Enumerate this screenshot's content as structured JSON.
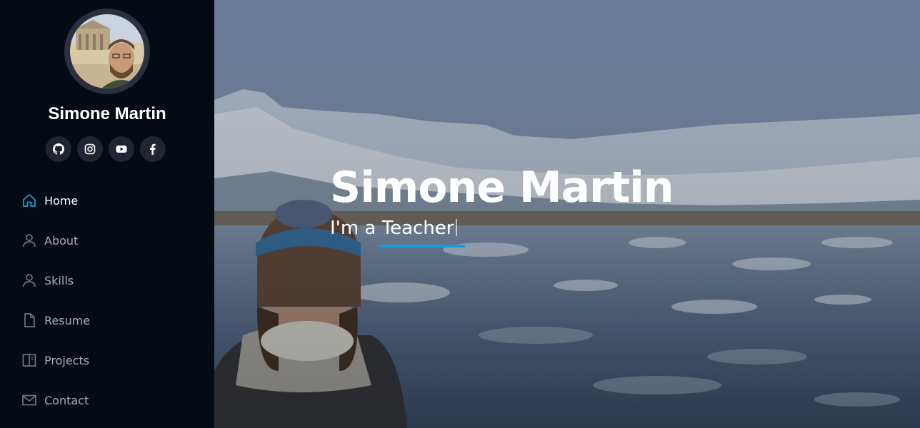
{
  "profile": {
    "name": "Simone Martin",
    "avatar_alt": "profile photo"
  },
  "socials": [
    {
      "icon": "github-icon"
    },
    {
      "icon": "instagram-icon"
    },
    {
      "icon": "youtube-icon"
    },
    {
      "icon": "facebook-icon"
    }
  ],
  "nav": {
    "items": [
      {
        "label": "Home",
        "icon": "home-icon",
        "active": true
      },
      {
        "label": "About",
        "icon": "person-icon"
      },
      {
        "label": "Skills",
        "icon": "person-icon"
      },
      {
        "label": "Resume",
        "icon": "file-icon"
      },
      {
        "label": "Projects",
        "icon": "columns-icon"
      },
      {
        "label": "Contact",
        "icon": "envelope-icon"
      }
    ]
  },
  "hero": {
    "title": "Simone Martin",
    "subtitle": "I'm a Teacher"
  },
  "colors": {
    "accent": "#149ddd",
    "sidebar_bg": "#040b14",
    "nav_text": "#a8a9b4",
    "social_bg": "#212431"
  }
}
